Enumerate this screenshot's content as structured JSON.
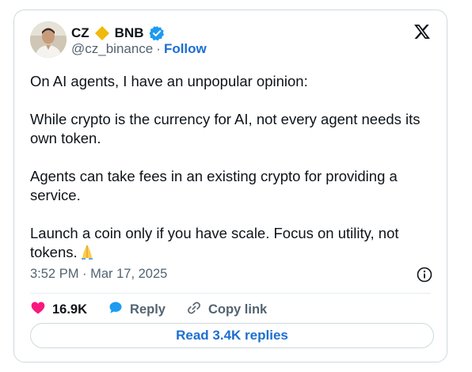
{
  "author": {
    "name": "CZ",
    "org_name": "BNB",
    "handle": "@cz_binance",
    "separator": "·",
    "follow_label": "Follow"
  },
  "tweet": {
    "paragraphs": [
      "On AI agents, I have an unpopular opinion:",
      "While crypto is the currency for AI, not every agent needs its own token.",
      "Agents can take fees in an existing crypto for providing a service.",
      "Launch a coin only if you have scale. Focus on utility, not tokens."
    ],
    "emoji": "folded-hands-emoji",
    "timestamp": "3:52 PM · Mar 17, 2025"
  },
  "actions": {
    "likes": "16.9K",
    "reply_label": "Reply",
    "copy_link_label": "Copy link"
  },
  "read_replies_label": "Read 3.4K replies",
  "colors": {
    "accent_blue": "#1d6fd0",
    "like_pink": "#f91880",
    "bnb_yellow": "#f0b90b",
    "muted_text": "#536471"
  },
  "icons": {
    "brand": "x-logo-icon",
    "info": "info-icon",
    "verified": "verified-badge-icon"
  }
}
